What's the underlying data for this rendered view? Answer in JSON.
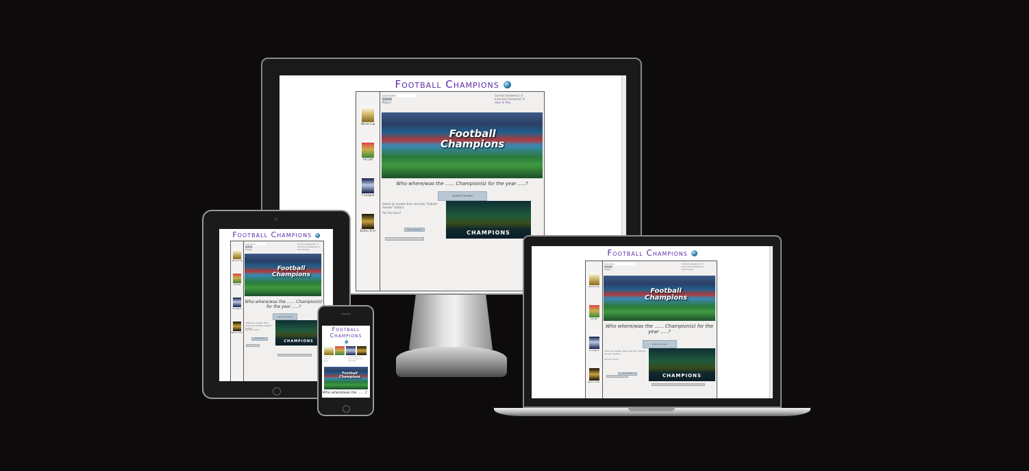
{
  "app": {
    "title": "Football Champions",
    "status": {
      "username": "username",
      "submit": "Submit",
      "player": "Player:"
    },
    "score": {
      "correct": "Correct Answer(s): 0",
      "incorrect": "Incorrect Answer(s): 0",
      "how_to": "How To Play"
    },
    "categories": [
      "World Cup",
      "AFCON",
      "C-League",
      "Ballon D'Or"
    ],
    "banner_text": [
      "Football",
      "Champions"
    ],
    "question": "Who where/was the ...... Champion(s) for the year .....?",
    "submit_answer": "Submit Answer",
    "instruction": "Select an answer then click the \"Submit Answer\" button.",
    "answer_placeholder": "Are You Sure?",
    "next_question": "Next Question",
    "champions_label": "CHAMPIONS"
  },
  "colors": {
    "title": "#5b2aa6",
    "background": "#0d0b0c",
    "button": "#b9c7d3"
  }
}
